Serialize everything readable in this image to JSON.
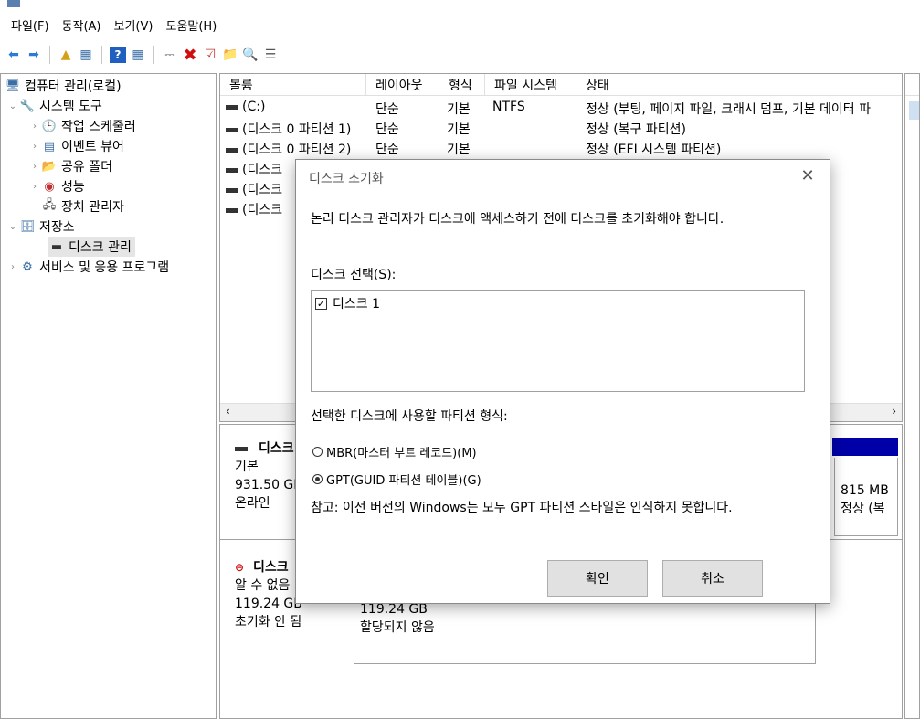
{
  "menu": [
    "파일(F)",
    "동작(A)",
    "보기(V)",
    "도움말(H)"
  ],
  "tree": {
    "root": "컴퓨터 관리(로컬)",
    "system_tools": "시스템 도구",
    "task_scheduler": "작업 스케줄러",
    "event_viewer": "이벤트 뷰어",
    "shared_folders": "공유 폴더",
    "performance": "성능",
    "device_manager": "장치 관리자",
    "storage": "저장소",
    "disk_management": "디스크 관리",
    "services": "서비스 및 응용 프로그램"
  },
  "volumes": {
    "headers": [
      "볼륨",
      "레이아웃",
      "형식",
      "파일 시스템",
      "상태"
    ],
    "rows": [
      {
        "name": "(C:)",
        "layout": "단순",
        "type": "기본",
        "fs": "NTFS",
        "status": "정상 (부팅, 페이지 파일, 크래시 덤프, 기본 데이터 파"
      },
      {
        "name": "(디스크 0 파티션 1)",
        "layout": "단순",
        "type": "기본",
        "fs": "",
        "status": "정상 (복구 파티션)"
      },
      {
        "name": "(디스크 0 파티션 2)",
        "layout": "단순",
        "type": "기본",
        "fs": "",
        "status": "정상 (EFI 시스템 파티션)"
      },
      {
        "name": "(디스크",
        "layout": "",
        "type": "",
        "fs": "",
        "status": ""
      },
      {
        "name": "(디스크",
        "layout": "",
        "type": "",
        "fs": "",
        "status": ""
      },
      {
        "name": "(디스크",
        "layout": "",
        "type": "",
        "fs": "",
        "status": ""
      }
    ]
  },
  "disks": {
    "disk0": {
      "label": "디스크",
      "type": "기본",
      "size": "931.50 GB",
      "state": "온라인",
      "part_size": "815 MB",
      "part_status": "정상 (복"
    },
    "disk1": {
      "label": "디스크",
      "type": "알 수 없음",
      "size": "119.24 GB",
      "state": "초기화 안 됨",
      "unalloc_size": "119.24 GB",
      "unalloc_label": "할당되지 않음"
    }
  },
  "dialog": {
    "title": "디스크 초기화",
    "message": "논리 디스크 관리자가 디스크에 액세스하기 전에 디스크를 초기화해야 합니다.",
    "select_label": "디스크 선택(S):",
    "disk_item": "디스크 1",
    "partition_label": "선택한 디스크에 사용할 파티션 형식:",
    "mbr_option": "MBR(마스터 부트 레코드)(M)",
    "gpt_option": "GPT(GUID 파티션 테이블)(G)",
    "note": "참고: 이전 버전의 Windows는 모두 GPT 파티션 스타일은 인식하지 못합니다.",
    "ok": "확인",
    "cancel": "취소"
  },
  "colors": {
    "accent": "#0000a8",
    "selection": "#e5e5e5"
  }
}
